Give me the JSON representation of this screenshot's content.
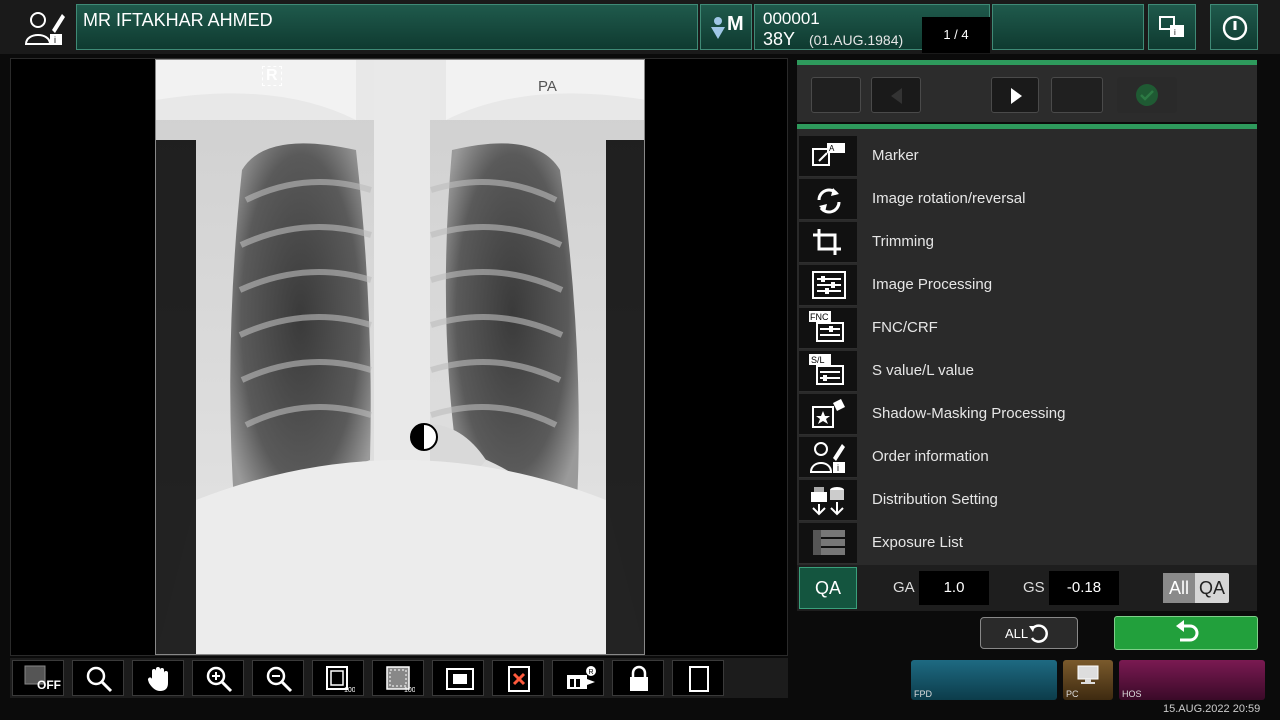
{
  "header": {
    "patient_name": "MR IFTAKHAR AHMED",
    "sex": "M",
    "patient_id": "000001",
    "age": "38Y",
    "dob": "(01.AUG.1984)"
  },
  "viewer": {
    "marker_r": "R",
    "projection": "PA"
  },
  "toolbar": {
    "off_label": "OFF"
  },
  "nav": {
    "page_indicator": "1 / 4"
  },
  "menu": {
    "items": [
      {
        "label": "Marker",
        "icon": "marker-icon"
      },
      {
        "label": "Image rotation/reversal",
        "icon": "rotation-icon"
      },
      {
        "label": "Trimming",
        "icon": "crop-icon"
      },
      {
        "label": "Image Processing",
        "icon": "image-processing-icon"
      },
      {
        "label": "FNC/CRF",
        "icon": "fnc-crf-icon"
      },
      {
        "label": "S value/L value",
        "icon": "sl-value-icon"
      },
      {
        "label": "Shadow-Masking Processing",
        "icon": "shadow-masking-icon"
      },
      {
        "label": "Order information",
        "icon": "order-info-icon"
      },
      {
        "label": "Distribution Setting",
        "icon": "distribution-icon"
      },
      {
        "label": "Exposure List",
        "icon": "exposure-list-icon"
      }
    ],
    "icon_text_fnc": "FNC",
    "icon_text_sl": "S/L"
  },
  "qa": {
    "button": "QA",
    "ga_label": "GA",
    "ga_value": "1.0",
    "gs_label": "GS",
    "gs_value": "-0.18",
    "all_label": "All",
    "qa_label": "QA"
  },
  "actions": {
    "all_undo_label": "ALL"
  },
  "status": {
    "fpd": "FPD",
    "pc": "PC",
    "hos": "HOS",
    "datetime": "15.AUG.2022 20:59"
  },
  "colors": {
    "accent_green": "#2e9a5c",
    "header_teal": "#1f5a4c",
    "confirm_green": "#22a03c"
  }
}
